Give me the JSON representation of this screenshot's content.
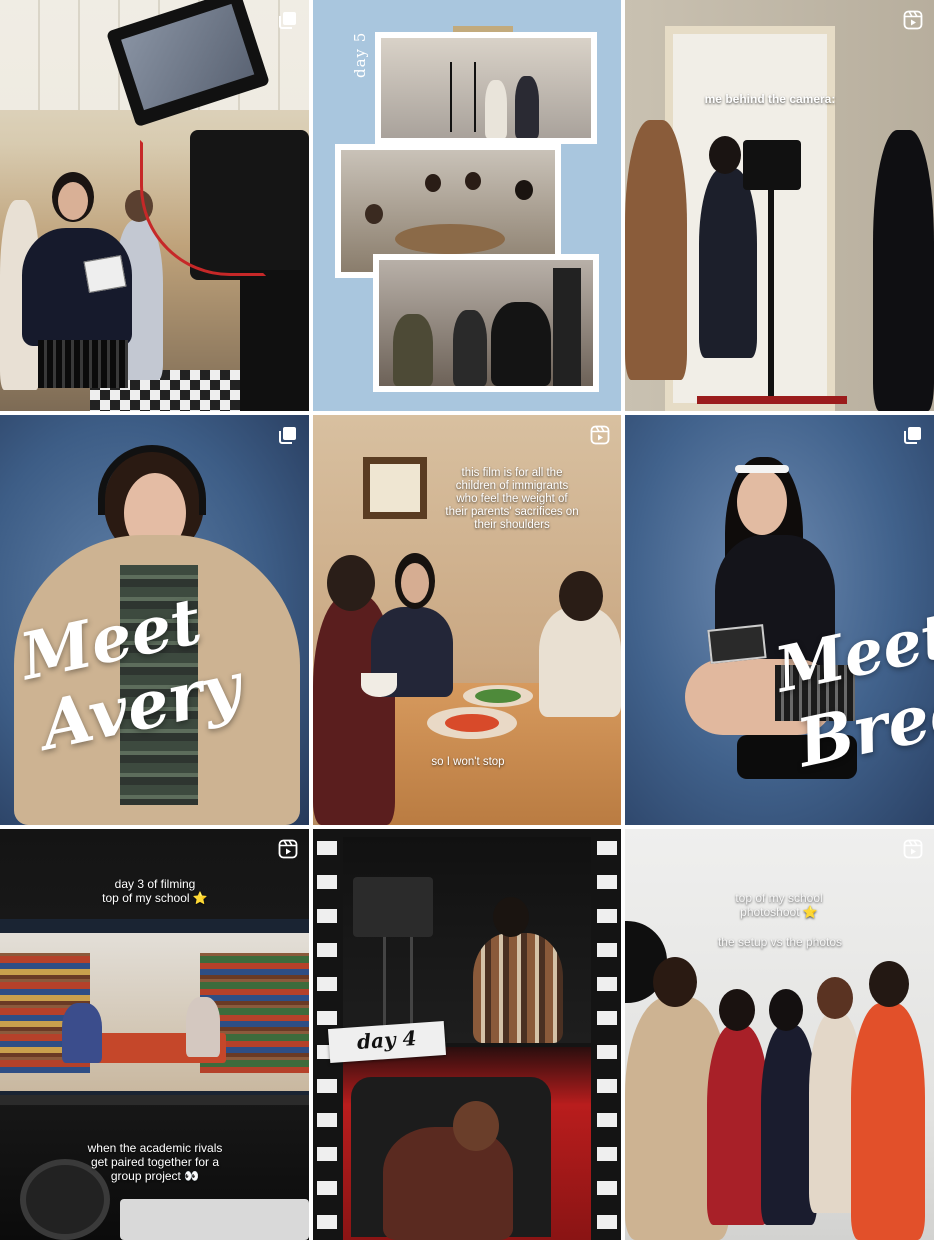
{
  "grid": {
    "posts": [
      {
        "type": "carousel",
        "type_icon": "carousel-icon"
      },
      {
        "type": "carousel",
        "type_icon": "none",
        "label": "day 5"
      },
      {
        "type": "reel",
        "type_icon": "reel-icon",
        "caption": "me behind the camera:"
      },
      {
        "type": "carousel",
        "type_icon": "carousel-icon",
        "script_line1": "Meet",
        "script_line2": "Avery"
      },
      {
        "type": "reel",
        "type_icon": "reel-icon",
        "caption_top": "this film is for all the\nchildren of immigrants\nwho feel the weight of\ntheir parents' sacrifices on\ntheir shoulders",
        "caption_bottom": "so I won't stop"
      },
      {
        "type": "carousel",
        "type_icon": "carousel-icon",
        "script_line1": "Meet",
        "script_line2": "Bree"
      },
      {
        "type": "reel",
        "type_icon": "reel-icon",
        "caption_top": "day 3 of filming\ntop of my school ⭐",
        "caption_bottom": "when the academic rivals\nget paired together for a\ngroup project 👀"
      },
      {
        "type": "carousel",
        "type_icon": "none",
        "label": "day 4"
      },
      {
        "type": "reel",
        "type_icon": "reel-icon",
        "caption_top": "top of my school\nphotoshoot ⭐",
        "caption_mid": "the setup vs the photos"
      }
    ]
  },
  "colors": {
    "gap": "#ffffff",
    "blue_paper": "#a9c6de",
    "blue_backdrop": "#3d5d86",
    "warm_wall": "#d9bf9e",
    "table_wood": "#c88a52",
    "library_blue": "#3b5a8f",
    "studio_white": "#e9e9e8",
    "film_black": "#141414"
  }
}
